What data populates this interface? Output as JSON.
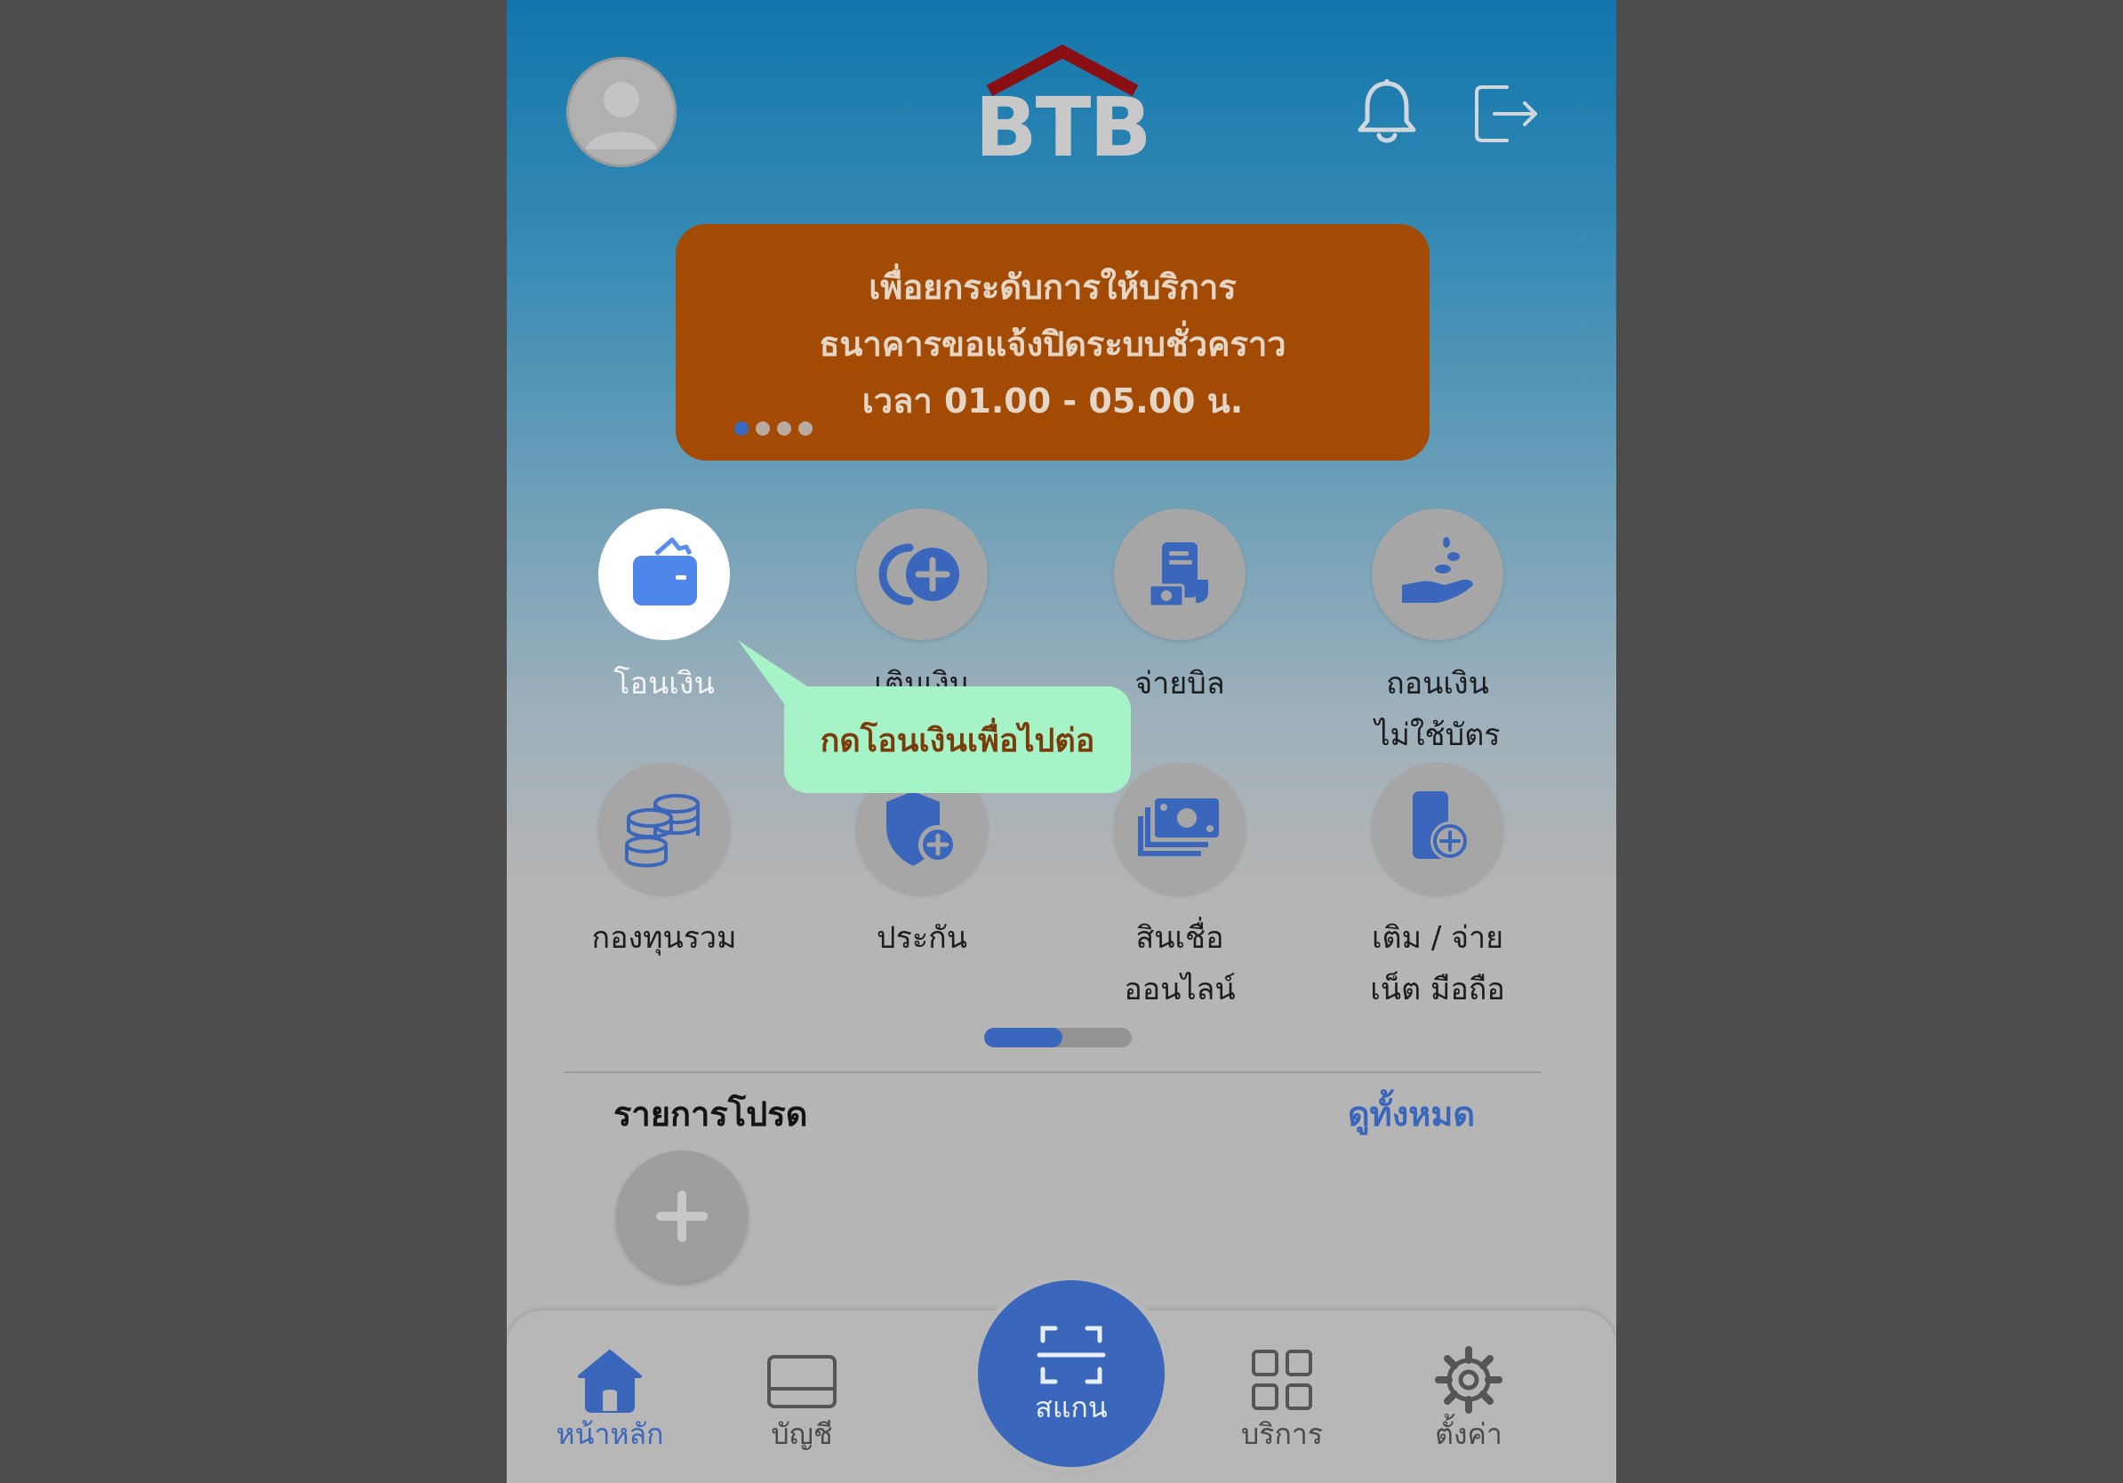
{
  "header": {
    "logo_text": "BTB",
    "avatar_icon": "user-avatar-icon",
    "notification_icon": "bell-icon",
    "logout_icon": "logout-icon"
  },
  "banner": {
    "line1": "เพื่อยกระดับการให้บริการ",
    "line2": "ธนาคารขอแจ้งปิดระบบชั่วคราว",
    "line3": "เวลา 01.00 - 05.00 น.",
    "page_count": 4,
    "active_page": 1
  },
  "services": [
    {
      "label1": "โอนเงิน",
      "label2": "",
      "icon": "wallet-icon"
    },
    {
      "label1": "เติมเงิน",
      "label2": "",
      "icon": "add-funds-icon"
    },
    {
      "label1": "จ่ายบิล",
      "label2": "",
      "icon": "bill-icon"
    },
    {
      "label1": "ถอนเงิน",
      "label2": "ไม่ใช้บัตร",
      "icon": "cardless-withdraw-icon"
    },
    {
      "label1": "กองทุนรวม",
      "label2": "",
      "icon": "coins-icon"
    },
    {
      "label1": "ประกัน",
      "label2": "",
      "icon": "insurance-shield-icon"
    },
    {
      "label1": "สินเชื่อ",
      "label2": "ออนไลน์",
      "icon": "cash-icon"
    },
    {
      "label1": "เติม / จ่าย",
      "label2": "เน็ต มือถือ",
      "icon": "mobile-topup-icon"
    }
  ],
  "tooltip": {
    "text": "กดโอนเงินเพื่อไปต่อ"
  },
  "services_pager": {
    "progress": 0.53
  },
  "favorites": {
    "title": "รายการโปรด",
    "view_all": "ดูทั้งหมด",
    "add_icon": "plus-icon"
  },
  "nav": {
    "home": "หน้าหลัก",
    "account": "บัญชี",
    "scan": "สแกน",
    "services": "บริการ",
    "settings": "ตั้งค่า"
  },
  "colors": {
    "accent": "#3a66bb",
    "banner": "#a34b05",
    "tooltip": "#a7f3c8",
    "logo_roof": "#8a0f12"
  }
}
